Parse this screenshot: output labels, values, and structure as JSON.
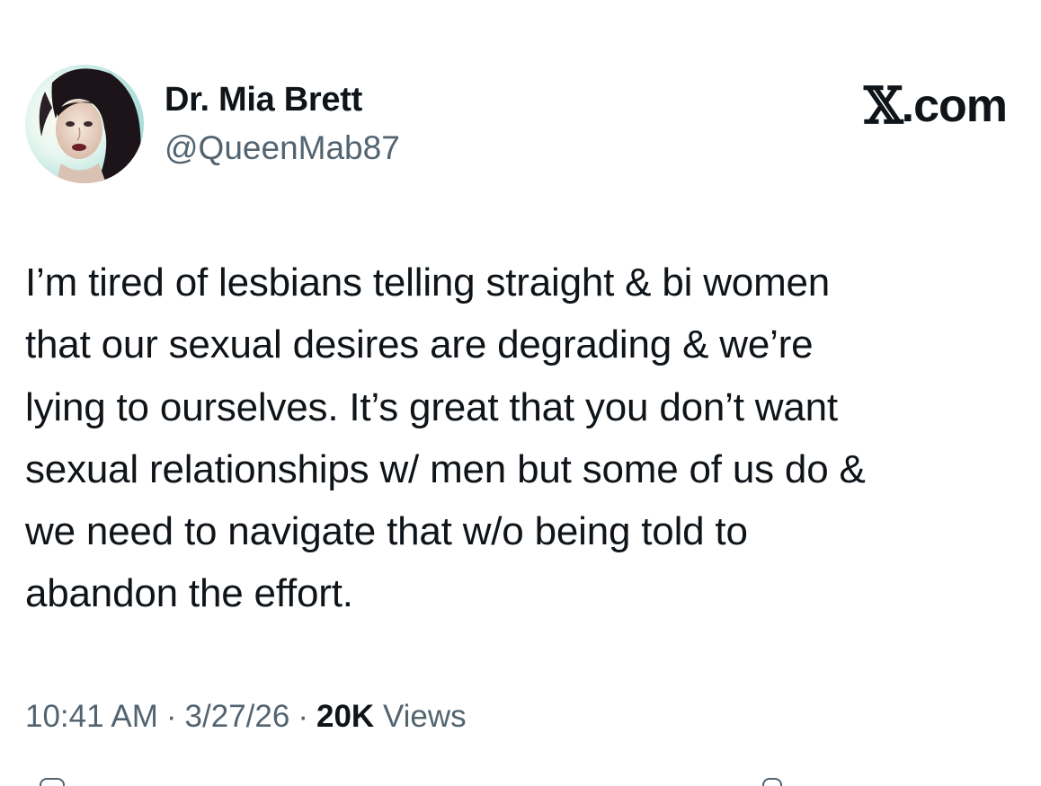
{
  "author": {
    "display_name": "Dr. Mia Brett",
    "handle": "@QueenMab87"
  },
  "brand": {
    "logo_letter": "𝕏",
    "logo_suffix": ".com"
  },
  "tweet": {
    "text": "I’m tired of lesbians telling straight & bi women\nthat our sexual desires are degrading & we’re\nlying to ourselves. It’s great that you don’t want\nsexual relationships w/ men but some of us do &\nwe need to navigate that w/o being told to\nabandon the effort."
  },
  "meta": {
    "time": "10:41 AM",
    "separator": "·",
    "date": "3/27/26",
    "views_count": "20K",
    "views_label": "Views"
  },
  "icons": {
    "avatar": "profile-photo",
    "action_bar": [
      "reply-icon",
      "bookmark-icon"
    ]
  },
  "colors": {
    "primary_text": "#0f1419",
    "secondary_text": "#536471",
    "background": "#ffffff"
  }
}
